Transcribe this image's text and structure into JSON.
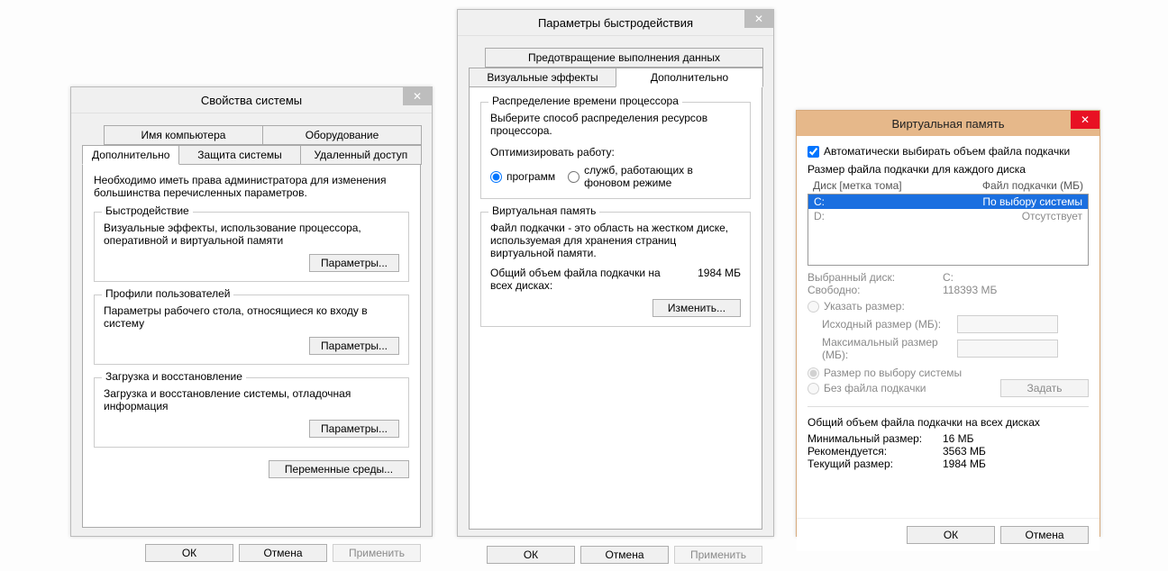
{
  "win1": {
    "title": "Свойства системы",
    "tabs_row1": [
      "Имя компьютера",
      "Оборудование"
    ],
    "tabs_row2": [
      "Дополнительно",
      "Защита системы",
      "Удаленный доступ"
    ],
    "active_tab": "Дополнительно",
    "intro": "Необходимо иметь права администратора для изменения большинства перечисленных параметров.",
    "g1": {
      "legend": "Быстродействие",
      "desc": "Визуальные эффекты, использование процессора, оперативной и виртуальной памяти",
      "btn": "Параметры..."
    },
    "g2": {
      "legend": "Профили пользователей",
      "desc": "Параметры рабочего стола, относящиеся ко входу в систему",
      "btn": "Параметры..."
    },
    "g3": {
      "legend": "Загрузка и восстановление",
      "desc": "Загрузка и восстановление системы, отладочная информация",
      "btn": "Параметры..."
    },
    "envbtn": "Переменные среды...",
    "ok": "ОК",
    "cancel": "Отмена",
    "apply": "Применить"
  },
  "win2": {
    "title": "Параметры быстродействия",
    "tabs_row1": [
      "Предотвращение выполнения данных"
    ],
    "tabs_row2": [
      "Визуальные эффекты",
      "Дополнительно"
    ],
    "active_tab": "Дополнительно",
    "g1": {
      "legend": "Распределение времени процессора",
      "desc": "Выберите способ распределения ресурсов процессора.",
      "optlabel": "Оптимизировать работу:",
      "opt1": "программ",
      "opt2": "служб, работающих в фоновом режиме",
      "selected": "opt1"
    },
    "g2": {
      "legend": "Виртуальная память",
      "desc": "Файл подкачки - это область на жестком диске, используемая для хранения страниц виртуальной памяти.",
      "totlabel": "Общий объем файла подкачки на всех дисках:",
      "totval": "1984 МБ",
      "btn": "Изменить..."
    },
    "ok": "ОК",
    "cancel": "Отмена",
    "apply": "Применить"
  },
  "win3": {
    "title": "Виртуальная память",
    "auto": "Автоматически выбирать объем файла подкачки",
    "hdr": "Размер файла подкачки для каждого диска",
    "col1": "Диск [метка тома]",
    "col2": "Файл подкачки (МБ)",
    "rows": [
      {
        "drive": "C:",
        "val": "По выбору системы",
        "sel": true
      },
      {
        "drive": "D:",
        "val": "Отсутствует",
        "sel": false
      }
    ],
    "seldrive_l": "Выбранный диск:",
    "seldrive_v": "C:",
    "free_l": "Свободно:",
    "free_v": "118393 МБ",
    "custom": "Указать размер:",
    "init": "Исходный размер (МБ):",
    "max": "Максимальный размер (МБ):",
    "sys": "Размер по выбору системы",
    "none": "Без файла подкачки",
    "set": "Задать",
    "sumhdr": "Общий объем файла подкачки на всех дисках",
    "min_l": "Минимальный размер:",
    "min_v": "16 МБ",
    "rec_l": "Рекомендуется:",
    "rec_v": "3563 МБ",
    "cur_l": "Текущий размер:",
    "cur_v": "1984 МБ",
    "ok": "ОК",
    "cancel": "Отмена"
  }
}
